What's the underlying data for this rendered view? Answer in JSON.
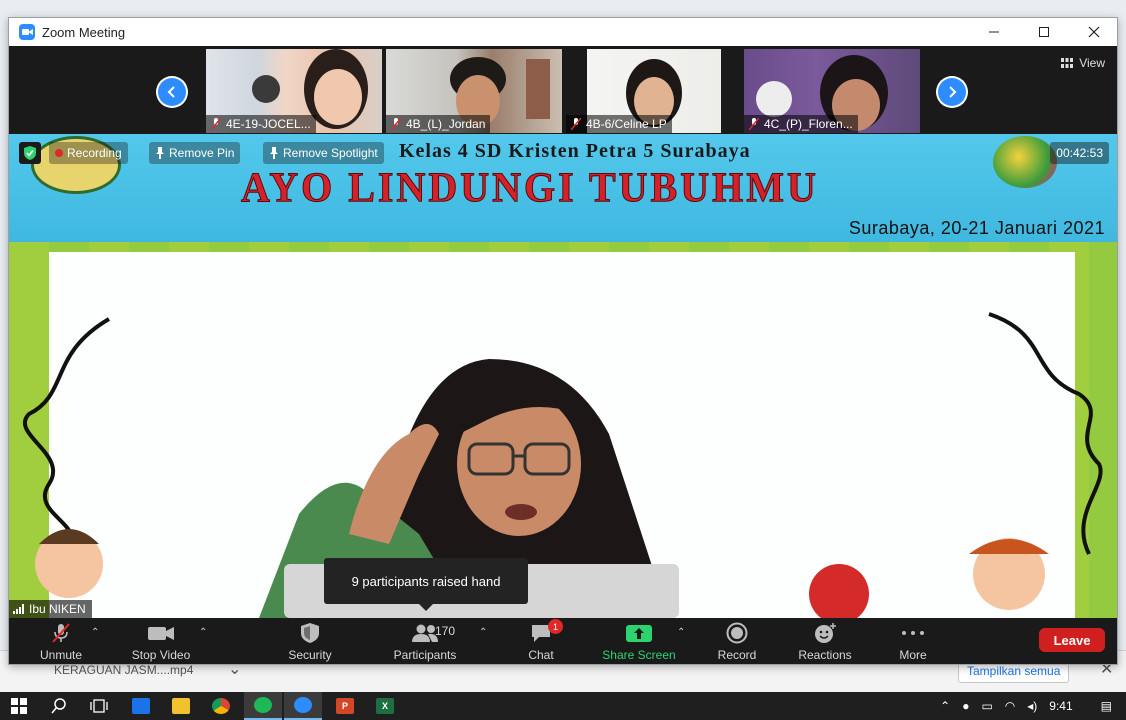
{
  "window": {
    "title": "Zoom Meeting",
    "minimize": "—",
    "maximize": "☐",
    "close": "✕"
  },
  "gallery": {
    "view_label": "View",
    "participants": [
      {
        "label": "4E-19-JOCEL..."
      },
      {
        "label": "4B_(L)_Jordan"
      },
      {
        "label": "4B-6/Celine LP"
      },
      {
        "label": "4C_(P)_Floren..."
      }
    ]
  },
  "main": {
    "recording_label": "Recording",
    "remove_pin_label": "Remove Pin",
    "remove_spotlight_label": "Remove Spotlight",
    "timer": "00:42:53",
    "banner_small": "Kelas 4 SD Kristen Petra 5 Surabaya",
    "banner_big": "AYO LINDUNGI TUBUHMU",
    "banner_date": "Surabaya, 20-21 Januari 2021",
    "speaker_name": "Ibu NIKEN",
    "tooltip": "9 participants raised hand"
  },
  "toolbar": {
    "unmute": "Unmute",
    "stop_video": "Stop Video",
    "security": "Security",
    "participants": "Participants",
    "participant_count": "170",
    "chat": "Chat",
    "chat_badge": "1",
    "share_screen": "Share Screen",
    "record": "Record",
    "reactions": "Reactions",
    "more": "More",
    "leave": "Leave"
  },
  "background": {
    "download_item": "KERAGUAN JASM....mp4",
    "show_all": "Tampilkan semua"
  },
  "taskbar": {
    "time": "9:41"
  },
  "colors": {
    "zoom_blue": "#2d8cff",
    "leave_red": "#d01f1f",
    "share_green": "#2dd36f",
    "banner_red": "#d5222a"
  }
}
